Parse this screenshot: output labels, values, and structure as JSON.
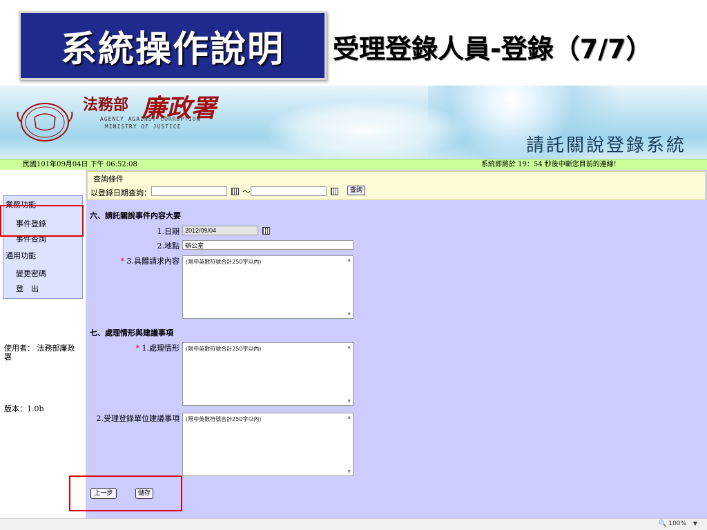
{
  "slide": {
    "title": "系統操作說明",
    "subtitle": "受理登錄人員-登錄（7/7）"
  },
  "banner": {
    "agency_prefix": "法務部",
    "agency_name": "廉政署",
    "agency_en_line1": "AGENCY AGAINST CORRUPTION",
    "agency_en_line2": "MINISTRY OF JUSTICE",
    "system_name": "請託關說登錄系統"
  },
  "status": {
    "datetime": "民國101年09月04日 下午 06:52:08",
    "timeout_message": "系統即將於 19：54 秒後中斷您目前的連線!"
  },
  "sidebar": {
    "group1_title": "業務功能",
    "items1": [
      "事件登錄",
      "事件查詢"
    ],
    "group2_title": "通用功能",
    "items2": [
      "變更密碼",
      "登　出"
    ],
    "user_label": "使用者：",
    "user_name": "法務部廉政署",
    "version": "版本：1.0b"
  },
  "query": {
    "legend": "查詢條件",
    "label": "以登錄日期查詢：",
    "date_from": "",
    "date_to": "",
    "tilde": "～",
    "search_button": "查詢"
  },
  "section6": {
    "title": "六、請託關說事件內容大要",
    "date_label": "1.日期",
    "date_value": "2012/09/04",
    "place_label": "2.地點",
    "place_value": "辦公室",
    "content_label": "3.具體請求內容",
    "content_required": "*",
    "content_placeholder": "(限中英數符號合計250字以內)"
  },
  "section7": {
    "title": "七、處理情形與建議事項",
    "handling_label": "1.處理情形",
    "handling_required": "*",
    "handling_placeholder": "(限中英數符號合計250字以內)",
    "suggest_label": "2.受理登錄單位建議事項",
    "suggest_placeholder": "(限中英數符號合計250字以內)"
  },
  "buttons": {
    "prev": "上一步",
    "save": "儲存"
  },
  "browser": {
    "zoom": "100%",
    "zoom_arrow": "▼"
  },
  "colors": {
    "title_bg": "#1f2a8c",
    "status_bar": "#ccff99",
    "main_bg": "#ccccff",
    "highlight": "#e00000",
    "required": "#e00000"
  }
}
